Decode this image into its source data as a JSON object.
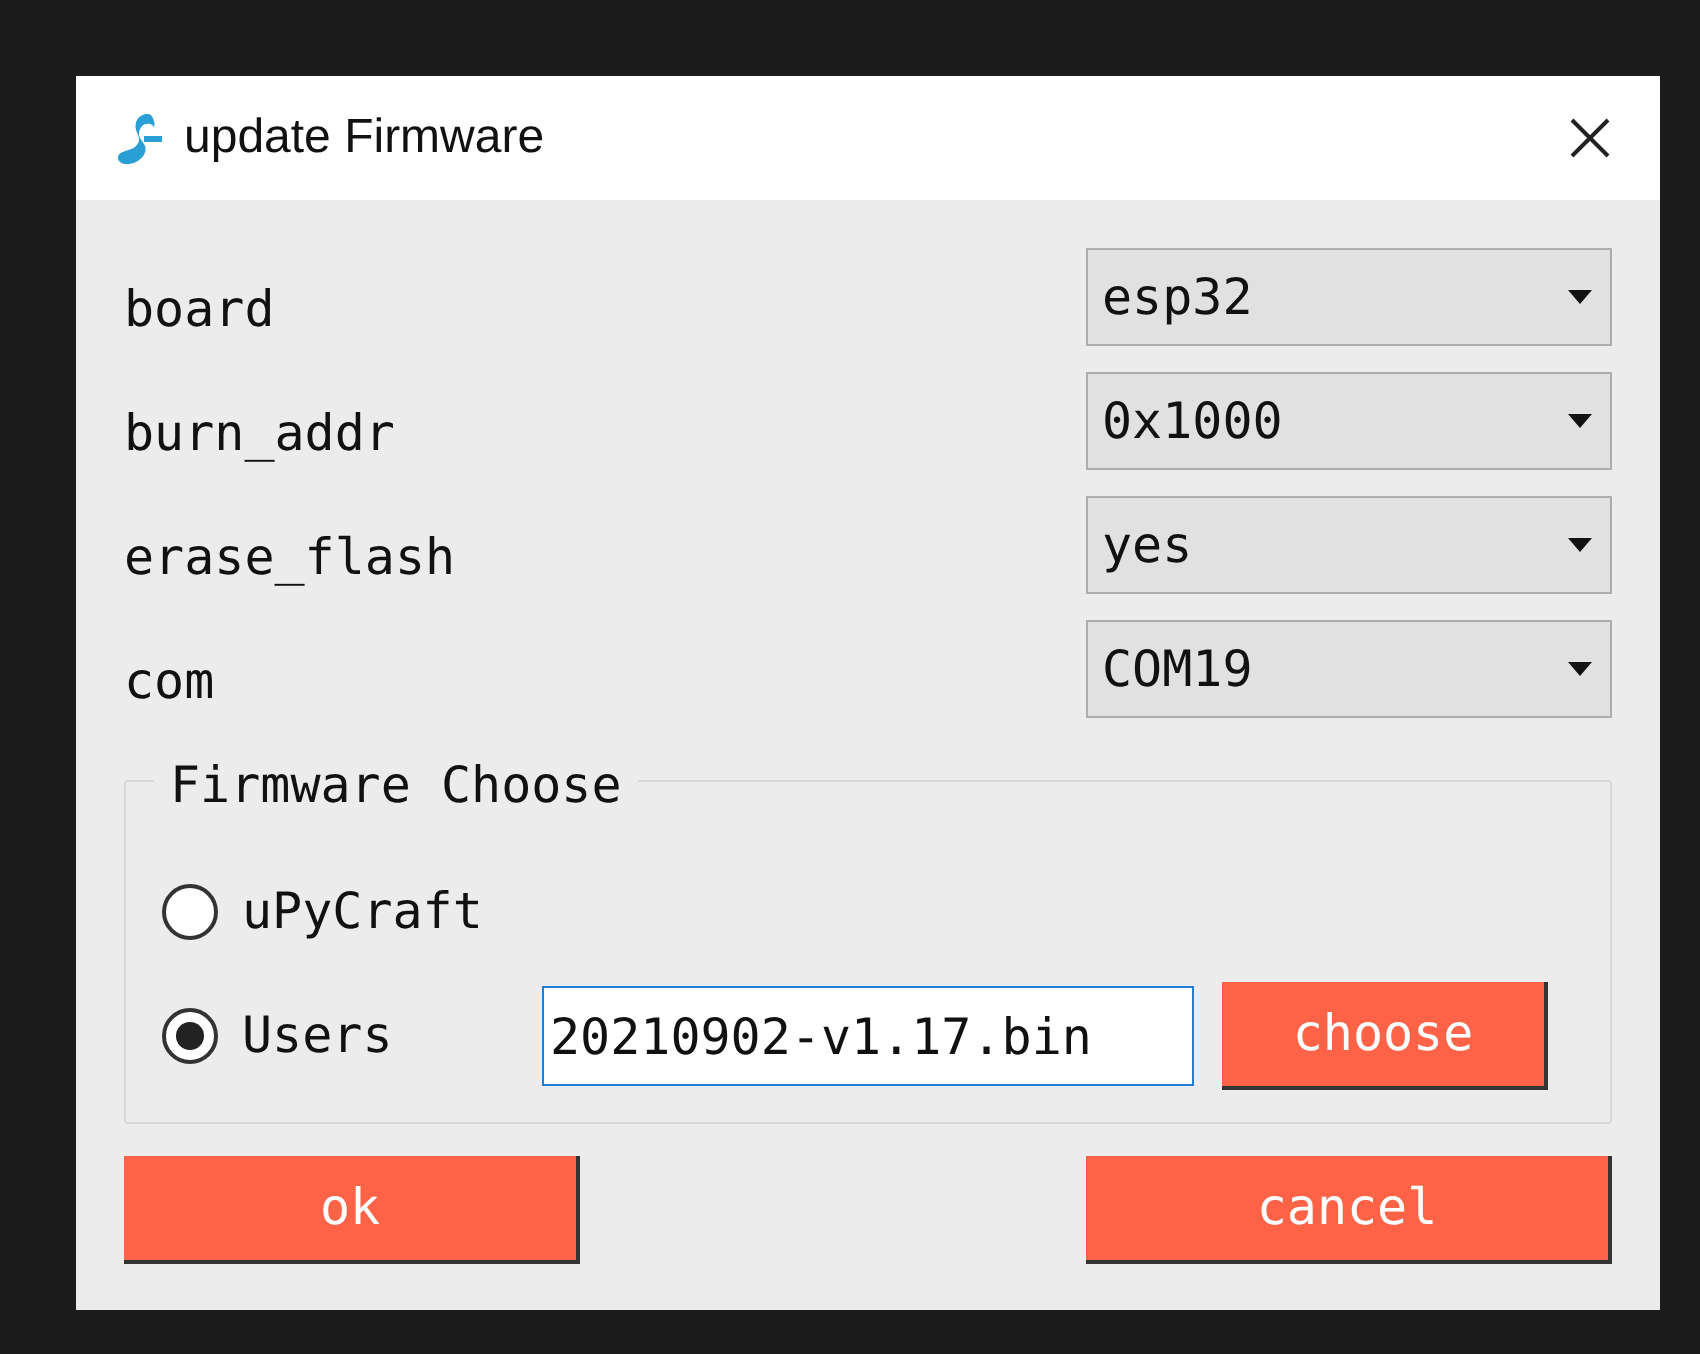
{
  "window": {
    "title": "update Firmware"
  },
  "settings": [
    {
      "label": "board",
      "value": "esp32"
    },
    {
      "label": "burn_addr",
      "value": "0x1000"
    },
    {
      "label": "erase_flash",
      "value": "yes"
    },
    {
      "label": "com",
      "value": "COM19"
    }
  ],
  "firmware_group": {
    "title": "Firmware Choose",
    "options": [
      {
        "label": "uPyCraft",
        "selected": false
      },
      {
        "label": "Users",
        "selected": true
      }
    ],
    "path_field": {
      "value": "20210902-v1.17.bin"
    },
    "choose_button": "choose"
  },
  "buttons": {
    "ok": "ok",
    "cancel": "cancel"
  }
}
